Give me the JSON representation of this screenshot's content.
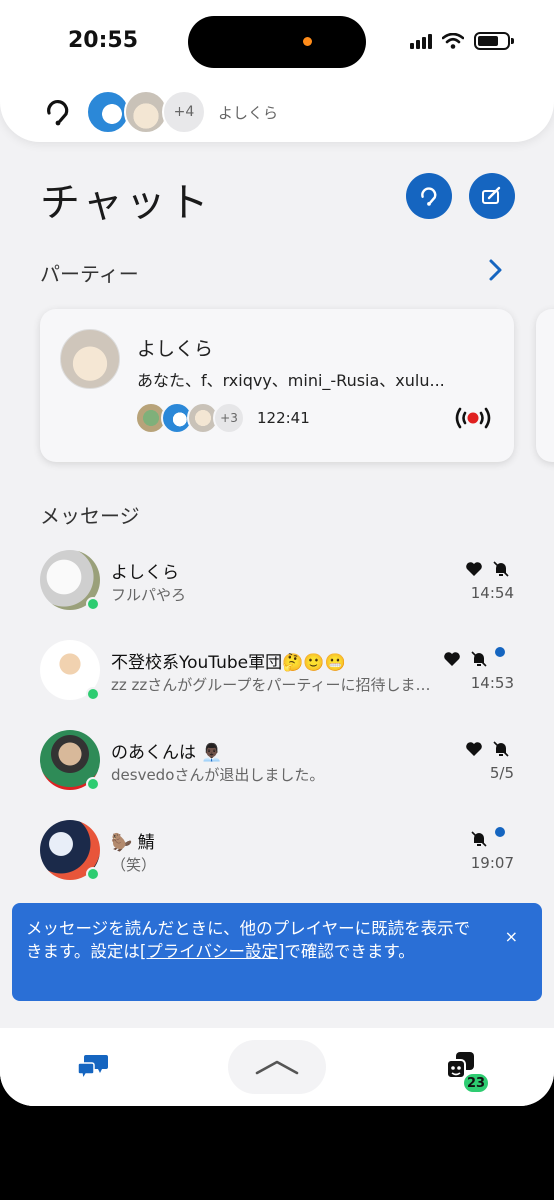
{
  "status_bar": {
    "time": "20:55"
  },
  "party_strip": {
    "more_count": "+4",
    "name": "よしくら"
  },
  "page": {
    "title": "チャット"
  },
  "party_section": {
    "label": "パーティー",
    "card": {
      "name": "よしくら",
      "members": "あなた、f、rxiqvy、mini_-Rusia、xulu...",
      "more_count": "+3",
      "timer": "122:41"
    }
  },
  "messages_section": {
    "label": "メッセージ",
    "items": [
      {
        "name": "よしくら",
        "preview": "フルパやろ",
        "time": "14:54",
        "favorite": true,
        "muted": true,
        "unread": false,
        "online": true
      },
      {
        "name": "不登校系YouTube軍団🤔🙂😬",
        "preview": "zz zzさんがグループをパーティーに招待しま…",
        "time": "14:53",
        "favorite": true,
        "muted": true,
        "unread": true,
        "online": true
      },
      {
        "name": "のあくんは 👨🏿‍💼",
        "preview": "desvedoさんが退出しました。",
        "time": "5/5",
        "favorite": true,
        "muted": true,
        "unread": false,
        "online": true
      },
      {
        "name": "🦫 鯖",
        "preview": "（笑）",
        "time": "19:07",
        "favorite": false,
        "muted": true,
        "unread": true,
        "online": true
      }
    ]
  },
  "toast": {
    "text_before": "メッセージを読んだときに、他のプレイヤーに既読を表示できます。設定は",
    "link": "[プライバシー設定]",
    "text_after": "で確認できます。",
    "close": "×"
  },
  "tab_bar": {
    "friends_badge": "23"
  },
  "colors": {
    "accent": "#1565c0",
    "online": "#2ecc71",
    "toast": "#2a6fd6"
  }
}
